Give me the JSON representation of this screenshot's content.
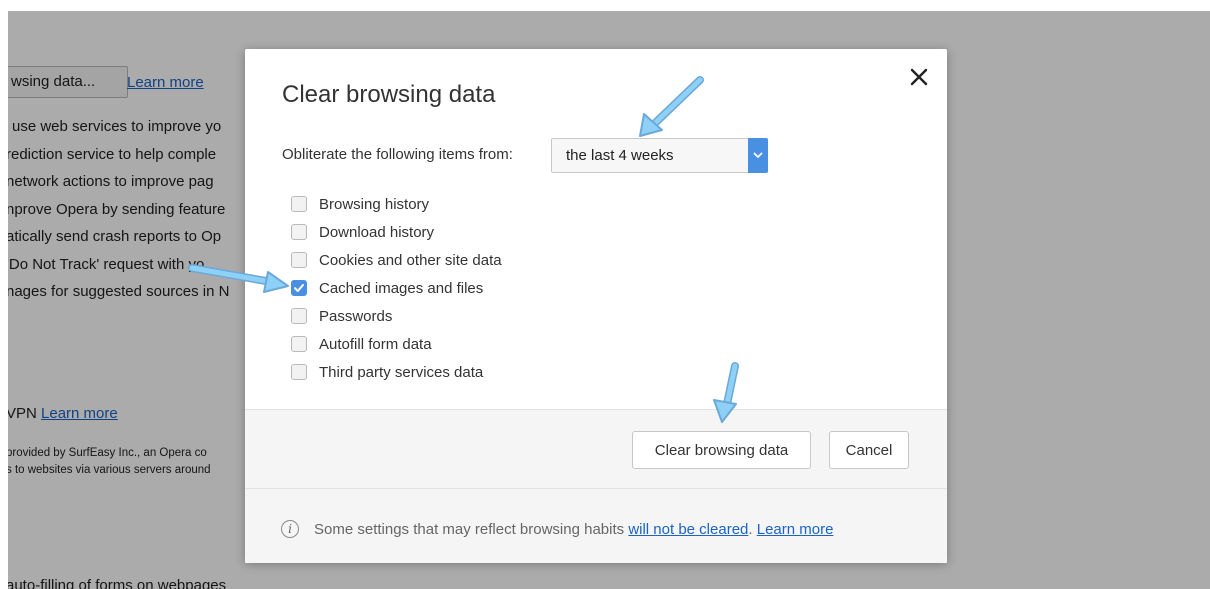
{
  "background": {
    "clear_button_label": "wsing data...",
    "learn_more": "Learn more",
    "lines": [
      "use web services to improve yo",
      "rediction service to help comple",
      "network actions to improve pag",
      "nprove Opera by sending feature",
      "atically send crash reports to Op",
      "'Do Not Track' request with yo",
      "nages for suggested sources in N"
    ],
    "vpn_label": "VPN",
    "vpn_learn_more": "Learn more",
    "vpn_desc_1": "provided by SurfEasy Inc., an Opera co",
    "vpn_desc_2": "s to websites via various servers around",
    "autofill_line": "auto-filling of forms on webpages"
  },
  "dialog": {
    "title": "Clear browsing data",
    "range_label": "Obliterate the following items from:",
    "range_value": "the last 4 weeks",
    "options": [
      {
        "label": "Browsing history",
        "checked": false
      },
      {
        "label": "Download history",
        "checked": false
      },
      {
        "label": "Cookies and other site data",
        "checked": false
      },
      {
        "label": "Cached images and files",
        "checked": true
      },
      {
        "label": "Passwords",
        "checked": false
      },
      {
        "label": "Autofill form data",
        "checked": false
      },
      {
        "label": "Third party services data",
        "checked": false
      }
    ],
    "clear_button": "Clear browsing data",
    "cancel_button": "Cancel",
    "info_prefix": "Some settings that may reflect browsing habits ",
    "info_link": "will not be cleared",
    "info_sep": ". ",
    "info_learn_more": "Learn more"
  },
  "colors": {
    "accent": "#4a90e2",
    "annotation_arrow": "#7ec3f2",
    "link": "#1b63c6"
  }
}
